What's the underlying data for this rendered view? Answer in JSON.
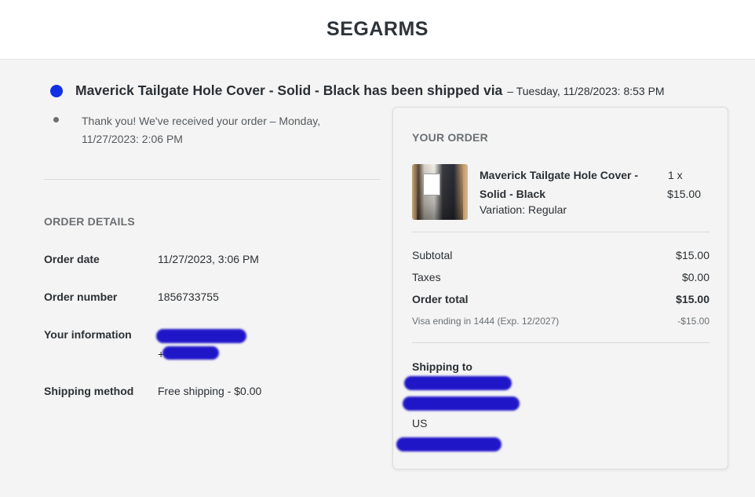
{
  "header": {
    "brand": "SEGARMS"
  },
  "timeline": {
    "shipped_text": "Maverick Tailgate Hole Cover - Solid - Black has been shipped via",
    "shipped_timestamp": "– Tuesday, 11/28/2023: 8:53 PM",
    "received_text": "Thank you! We've received your order – Monday, 11/27/2023: 2:06 PM"
  },
  "order_details": {
    "heading": "ORDER DETAILS",
    "rows": [
      {
        "label": "Order date",
        "value": "11/27/2023, 3:06 PM"
      },
      {
        "label": "Order number",
        "value": "1856733755"
      },
      {
        "label": "Your information",
        "value": "+"
      },
      {
        "label": "Shipping method",
        "value": "Free shipping - $0.00"
      }
    ]
  },
  "your_order": {
    "heading": "YOUR ORDER",
    "item": {
      "name": "Maverick Tailgate Hole Cover - Solid - Black",
      "variation": "Variation: Regular",
      "quantity": "1 x",
      "price": "$15.00"
    },
    "summary": {
      "subtotal_label": "Subtotal",
      "subtotal_value": "$15.00",
      "taxes_label": "Taxes",
      "taxes_value": "$0.00",
      "total_label": "Order total",
      "total_value": "$15.00",
      "payment_label": "Visa ending in 1444 (Exp. 12/2027)",
      "payment_value": "-$15.00"
    },
    "shipping": {
      "heading": "Shipping to",
      "country": "US"
    }
  },
  "colors": {
    "accent_dot": "#1230e6",
    "redaction": "#1f16c8",
    "background": "#f4f4f4"
  }
}
